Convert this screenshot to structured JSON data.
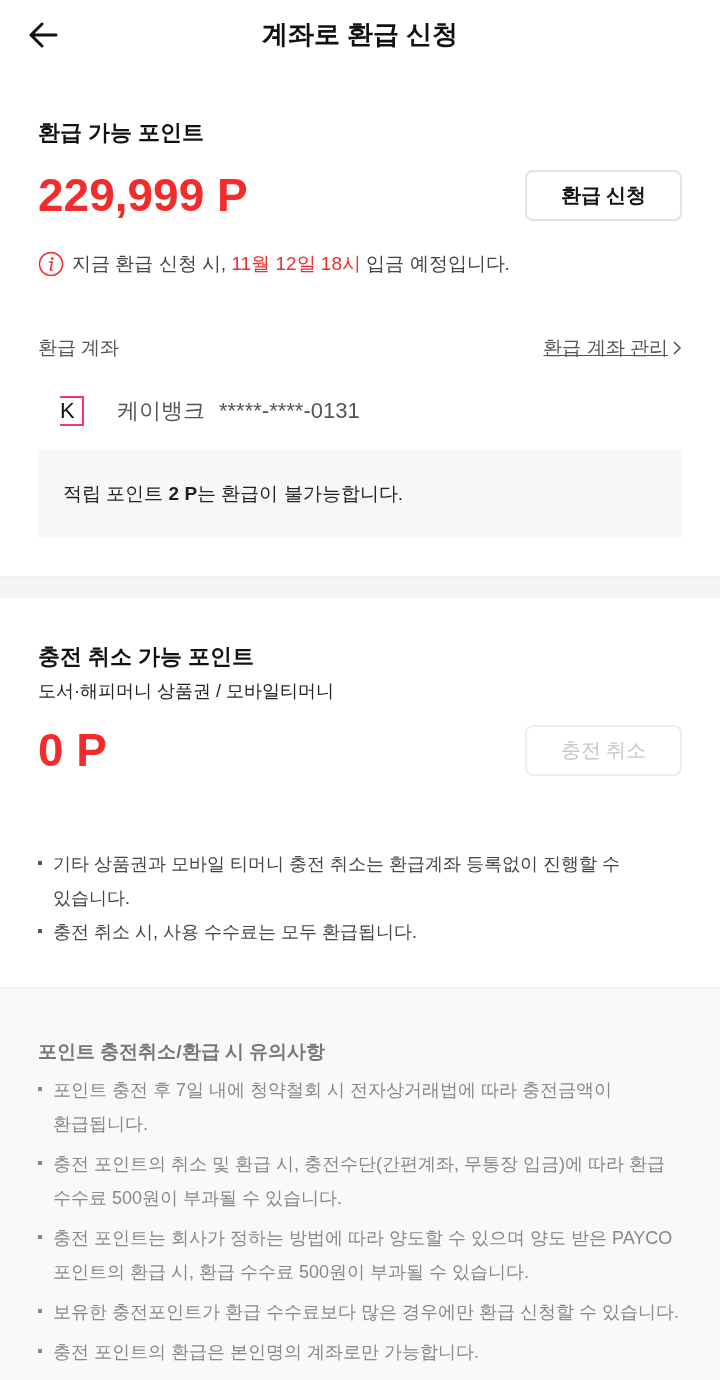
{
  "header": {
    "title": "계좌로 환급 신청"
  },
  "refund": {
    "title": "환급 가능 포인트",
    "amount": "229,999 P",
    "button": {
      "label": "환급 신청",
      "disabled": false
    },
    "notice": [
      {
        "text": "지금 환급 신청 시, ",
        "highlight": false
      },
      {
        "text": "11월 12일 18시",
        "highlight": true
      },
      {
        "text": " 입금 예정입니다.",
        "highlight": false
      }
    ]
  },
  "account": {
    "label": "환급 계좌",
    "manage_link": "환급 계좌 관리",
    "bank": {
      "logo": "K",
      "name": "케이뱅크",
      "number": "*****-****-0131"
    },
    "notice": "적립 포인트 **2 P**는 환급이 불가능합니다."
  },
  "charge_cancel": {
    "title": "충전 취소 가능 포인트",
    "subtitle": "도서·해피머니 상품권 / 모바일티머니",
    "amount": "0 P",
    "button": {
      "label": "충전 취소",
      "disabled": true
    },
    "notes": [
      "기타 상품권과 모바일 티머니 충전 취소는 환급계좌 등록없이 진행할 수 있습니다.",
      "충전 취소 시, 사용 수수료는 모두 환급됩니다."
    ]
  },
  "cautions": {
    "title": "포인트 충전취소/환급 시 유의사항",
    "items": [
      "포인트 충전 후 7일 내에 청약철회 시 전자상거래법에 따라 충전금액이 환급됩니다.",
      "충전 포인트의 취소 및 환급 시, 충전수단(간편계좌, 무통장 입금)에 따라 환급 수수료 500원이 부과될 수 있습니다.",
      "충전 포인트는 회사가 정하는 방법에 따라 양도할 수 있으며 양도 받은 PAYCO 포인트의 환급 시, 환급 수수료 500원이 부과될 수 있습니다.",
      "보유한 충전포인트가 환급 수수료보다 많은 경우에만 환급 신청할 수 있습니다.",
      "충전 포인트의 환급은 본인명의 계좌로만 가능합니다."
    ]
  }
}
